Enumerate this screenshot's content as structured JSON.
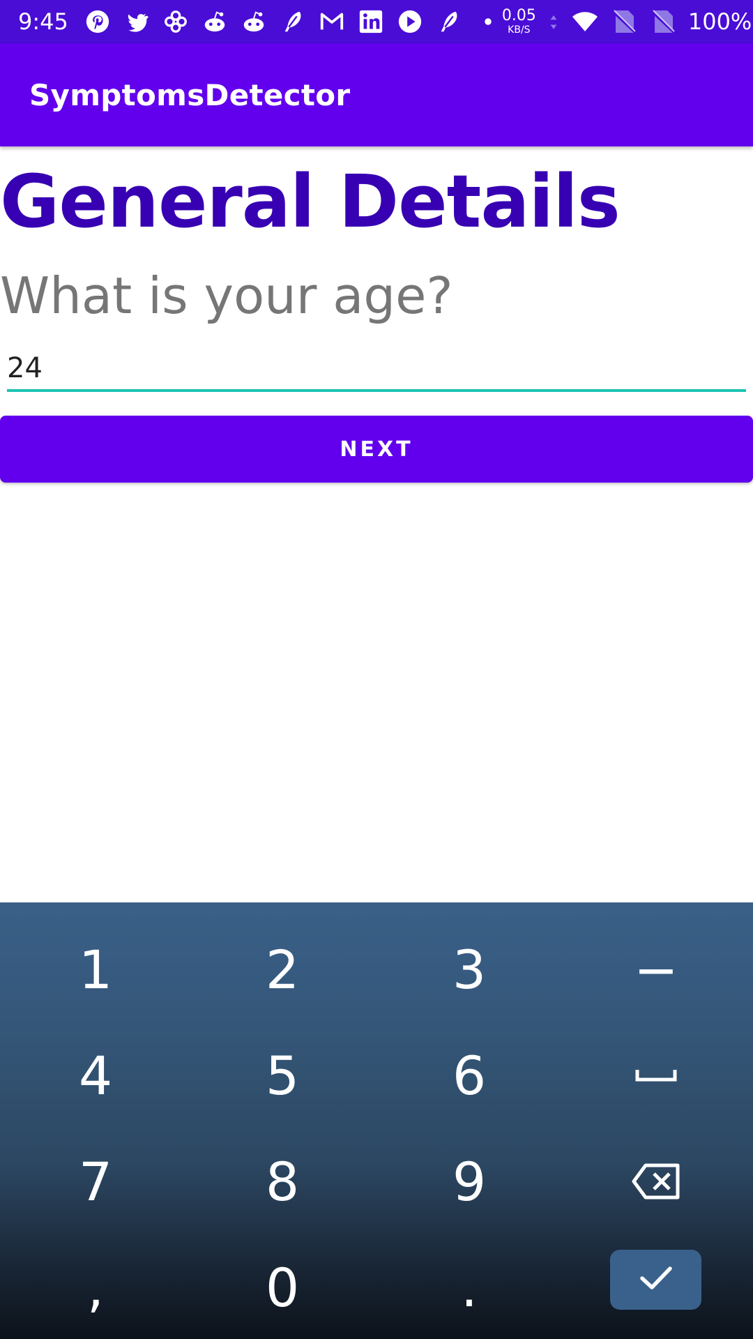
{
  "status_bar": {
    "time": "9:45",
    "notification_icons": [
      "pinterest-icon",
      "twitter-icon",
      "pinwheel-icon",
      "reddit-icon",
      "reddit-icon",
      "feather-icon",
      "gmail-icon",
      "linkedin-icon",
      "youtube-icon",
      "feather-icon",
      "dot-icon"
    ],
    "net_speed_value": "0.05",
    "net_speed_unit": "KB/S",
    "battery": "100%"
  },
  "app_bar": {
    "title": "SymptomsDetector"
  },
  "main": {
    "heading": "General Details",
    "question": "What is your age?",
    "age_value": "24",
    "next_label": "NEXT"
  },
  "keyboard": {
    "rows": [
      [
        "1",
        "2",
        "3",
        "−"
      ],
      [
        "4",
        "5",
        "6",
        "space-icon"
      ],
      [
        "7",
        "8",
        "9",
        "backspace-icon"
      ],
      [
        ",",
        "0",
        ".",
        "done-icon"
      ]
    ]
  },
  "colors": {
    "status_bar": "#4a0dd6",
    "app_bar": "#6200ee",
    "heading": "#3700b3",
    "input_underline": "#1dc3b3",
    "keyboard_top": "#3a6089",
    "keyboard_bottom": "#0c121a",
    "done_key": "#3a618c"
  }
}
